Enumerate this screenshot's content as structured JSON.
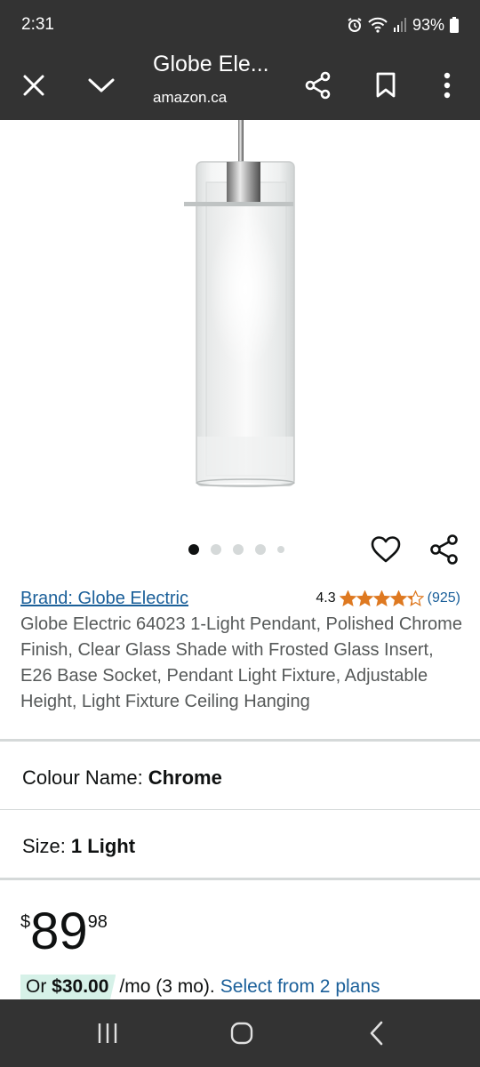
{
  "status_bar": {
    "time": "2:31",
    "battery": "93%"
  },
  "browser_bar": {
    "title": "Globe Ele...",
    "domain": "amazon.ca"
  },
  "product": {
    "brand_link": "Brand: Globe Electric",
    "rating_value": "4.3",
    "rating_fraction": 0.86,
    "rating_count": "(925)",
    "title": "Globe Electric 64023 1-Light Pendant, Polished Chrome Finish, Clear Glass Shade with Frosted Glass Insert, E26 Base Socket, Pendant Light Fixture, Adjustable Height, Light Fixture Ceiling Hanging",
    "carousel": {
      "total": 5,
      "active_index": 0
    }
  },
  "options": {
    "colour_label": "Colour Name:",
    "colour_value": "Chrome",
    "size_label": "Size:",
    "size_value": "1 Light"
  },
  "price": {
    "currency": "$",
    "whole": "89",
    "fraction": "98"
  },
  "financing": {
    "or": "Or",
    "amount": "$30.00",
    "term": "/mo (3 mo).",
    "link": "Select from 2 plans"
  },
  "colors": {
    "accent_link": "#1a5f99",
    "star": "#de7921",
    "bar": "#333333",
    "financing_bg": "#d6f1e8"
  }
}
